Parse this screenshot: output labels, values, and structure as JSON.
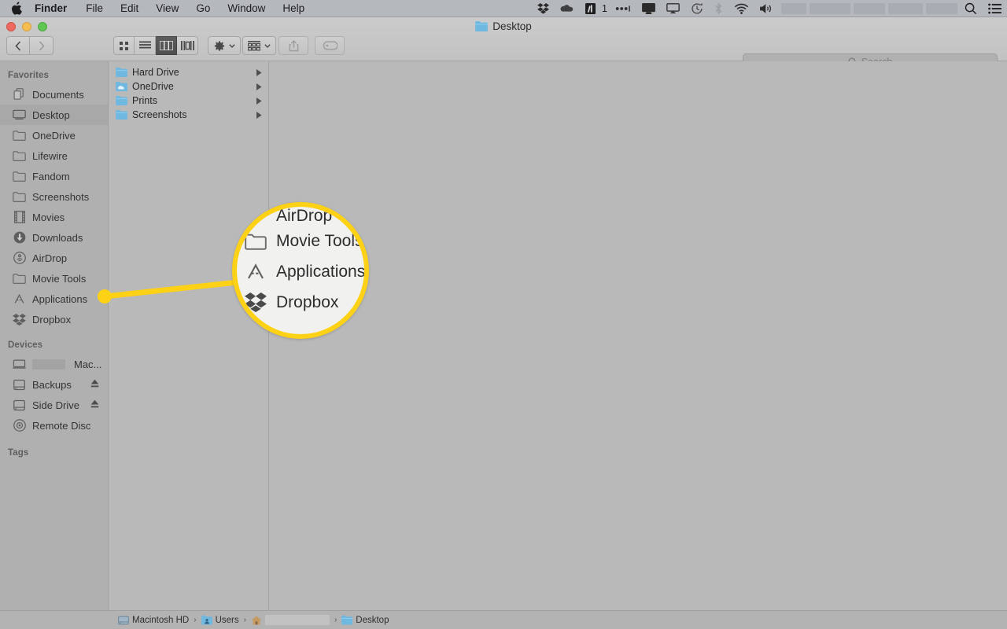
{
  "menubar": {
    "apple_icon": "apple-logo-icon",
    "items": [
      {
        "label": "Finder",
        "bold": true
      },
      {
        "label": "File",
        "bold": false
      },
      {
        "label": "Edit",
        "bold": false
      },
      {
        "label": "View",
        "bold": false
      },
      {
        "label": "Go",
        "bold": false
      },
      {
        "label": "Window",
        "bold": false
      },
      {
        "label": "Help",
        "bold": false
      }
    ],
    "status_icons": [
      {
        "name": "dropbox-icon"
      },
      {
        "name": "onedrive-cloud-icon"
      },
      {
        "name": "adobe-app-icon"
      },
      {
        "name": "notification-dots-icon"
      },
      {
        "name": "display-icon"
      },
      {
        "name": "airplay-icon"
      },
      {
        "name": "time-machine-icon"
      },
      {
        "name": "bluetooth-icon"
      },
      {
        "name": "wifi-icon"
      },
      {
        "name": "volume-icon"
      },
      {
        "name": "spotlight-search-icon"
      },
      {
        "name": "notification-center-icon"
      }
    ],
    "adobe_badge_count": "1"
  },
  "window": {
    "title": "Desktop",
    "title_icon": "folder-icon",
    "traffic_lights": {
      "close_color": "#ee6a5f",
      "minimize_color": "#f5bd4f",
      "zoom_color": "#61c554"
    }
  },
  "toolbar": {
    "back_label": "‹",
    "forward_label": "›",
    "view_modes": [
      {
        "name": "icon-view",
        "active": false
      },
      {
        "name": "list-view",
        "active": false
      },
      {
        "name": "column-view",
        "active": true
      },
      {
        "name": "gallery-view",
        "active": false
      }
    ],
    "action_menu": "gear-icon",
    "arrange_menu": "arrange-grid-icon",
    "share_button": "share-icon",
    "tag_button": "tag-icon"
  },
  "search": {
    "placeholder": "Search",
    "value": "",
    "icon": "search-icon"
  },
  "sidebar": {
    "sections": [
      {
        "header": "Favorites",
        "items": [
          {
            "label": "Documents",
            "icon": "documents-icon",
            "selected": false
          },
          {
            "label": "Desktop",
            "icon": "desktop-icon",
            "selected": true
          },
          {
            "label": "OneDrive",
            "icon": "folder-icon",
            "selected": false
          },
          {
            "label": "Lifewire",
            "icon": "folder-icon",
            "selected": false
          },
          {
            "label": "Fandom",
            "icon": "folder-icon",
            "selected": false
          },
          {
            "label": "Screenshots",
            "icon": "folder-icon",
            "selected": false
          },
          {
            "label": "Movies",
            "icon": "film-strip-icon",
            "selected": false
          },
          {
            "label": "Downloads",
            "icon": "downloads-icon",
            "selected": false
          },
          {
            "label": "AirDrop",
            "icon": "airdrop-icon",
            "selected": false
          },
          {
            "label": "Movie Tools",
            "icon": "folder-icon",
            "selected": false
          },
          {
            "label": "Applications",
            "icon": "applications-icon",
            "selected": false
          },
          {
            "label": "Dropbox",
            "icon": "dropbox-icon",
            "selected": false
          }
        ]
      },
      {
        "header": "Devices",
        "items": [
          {
            "label": "Mac...",
            "icon": "laptop-icon",
            "redacted": true,
            "selected": false
          },
          {
            "label": "Backups",
            "icon": "hard-disk-icon",
            "eject": true,
            "selected": false
          },
          {
            "label": "Side Drive",
            "icon": "hard-disk-icon",
            "eject": true,
            "selected": false
          },
          {
            "label": "Remote Disc",
            "icon": "optical-disc-icon",
            "selected": false
          }
        ]
      },
      {
        "header": "Tags",
        "items": []
      }
    ]
  },
  "column_view": {
    "rows": [
      {
        "label": "Hard Drive",
        "icon": "folder-icon",
        "has_children": true
      },
      {
        "label": "OneDrive",
        "icon": "onedrive-folder-icon",
        "has_children": true
      },
      {
        "label": "Prints",
        "icon": "folder-icon",
        "has_children": true
      },
      {
        "label": "Screenshots",
        "icon": "folder-icon",
        "has_children": true
      }
    ],
    "chevron": "▶"
  },
  "magnifier": {
    "highlight_color": "#fcd116",
    "rows": [
      {
        "label": "AirDrop",
        "icon": "airdrop-icon",
        "clipped": true
      },
      {
        "label": "Movie Tools",
        "icon": "folder-icon",
        "clipped": false
      },
      {
        "label": "Applications",
        "icon": "applications-icon",
        "clipped": false
      },
      {
        "label": "Dropbox",
        "icon": "dropbox-icon",
        "clipped": false
      }
    ]
  },
  "pathbar": {
    "segments": [
      {
        "label": "Macintosh HD",
        "icon": "hard-disk-icon"
      },
      {
        "label": "Users",
        "icon": "users-folder-icon"
      },
      {
        "label": "",
        "icon": "home-icon",
        "redacted": true
      },
      {
        "label": "Desktop",
        "icon": "folder-icon"
      }
    ],
    "separator": "›"
  }
}
